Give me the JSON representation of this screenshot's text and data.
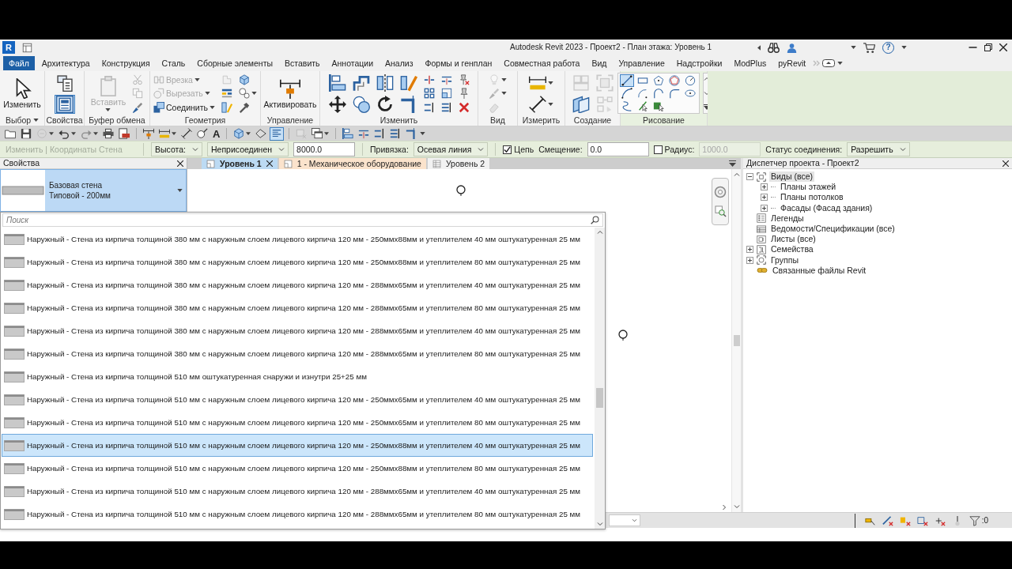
{
  "title_bar": {
    "logo": "R",
    "title": "Autodesk Revit 2023 - Проект2 - План этажа: Уровень 1",
    "help": "?"
  },
  "menu_tabs": [
    {
      "label": "Файл",
      "kind": "file",
      "selected": false
    },
    {
      "label": "Архитектура",
      "kind": "tab",
      "selected": false
    },
    {
      "label": "Конструкция",
      "kind": "tab",
      "selected": false
    },
    {
      "label": "Сталь",
      "kind": "tab",
      "selected": false
    },
    {
      "label": "Сборные элементы",
      "kind": "tab",
      "selected": false
    },
    {
      "label": "Вставить",
      "kind": "tab",
      "selected": false
    },
    {
      "label": "Аннотации",
      "kind": "tab",
      "selected": false
    },
    {
      "label": "Анализ",
      "kind": "tab",
      "selected": false
    },
    {
      "label": "Формы и генплан",
      "kind": "tab",
      "selected": false
    },
    {
      "label": "Совместная работа",
      "kind": "tab",
      "selected": false
    },
    {
      "label": "Вид",
      "kind": "tab",
      "selected": false
    },
    {
      "label": "Управление",
      "kind": "tab",
      "selected": false
    },
    {
      "label": "Надстройки",
      "kind": "tab",
      "selected": false
    },
    {
      "label": "ModPlus",
      "kind": "tab",
      "selected": false
    },
    {
      "label": "pyRevit",
      "kind": "tab",
      "selected": false
    }
  ],
  "ribbon": {
    "panels": [
      {
        "title": "Выбор",
        "kind": "tools",
        "menu": true,
        "columns": [
          [
            {
              "kind": "large",
              "label": "Изменить",
              "disabled": false,
              "menu": false,
              "on": false
            }
          ]
        ]
      },
      {
        "title": "Свойства",
        "kind": "tools",
        "menu": false,
        "columns": [
          [
            {
              "kind": "medium",
              "disabled": false,
              "menu": false,
              "on": false
            },
            {
              "kind": "medium",
              "disabled": false,
              "menu": false,
              "on": true
            }
          ]
        ]
      },
      {
        "title": "Буфер обмена",
        "kind": "tools",
        "menu": false,
        "columns": [
          [
            {
              "kind": "large",
              "label": "Вставить",
              "disabled": true,
              "menu": true,
              "on": false
            }
          ],
          [
            {
              "kind": "small",
              "disabled": true,
              "menu": false,
              "on": false
            },
            {
              "kind": "small",
              "disabled": true,
              "menu": false,
              "on": false
            },
            {
              "kind": "small",
              "disabled": false,
              "menu": false,
              "on": false
            }
          ]
        ]
      },
      {
        "title": "Геометрия",
        "kind": "tools",
        "menu": false,
        "columns": [
          [
            {
              "kind": "small",
              "label": "Врезка",
              "disabled": true,
              "menu": true,
              "on": false
            },
            {
              "kind": "small",
              "label": "Вырезать",
              "disabled": true,
              "menu": true,
              "on": false
            },
            {
              "kind": "small",
              "label": "Соединить",
              "disabled": false,
              "menu": true,
              "on": false
            }
          ],
          [
            {
              "kind": "small",
              "disabled": true,
              "menu": false,
              "on": false
            },
            {
              "kind": "small",
              "disabled": false,
              "menu": false,
              "on": false
            },
            {
              "kind": "small",
              "disabled": false,
              "menu": false,
              "on": false
            }
          ],
          [
            {
              "kind": "small",
              "disabled": false,
              "menu": false,
              "on": false
            },
            {
              "kind": "small",
              "disabled": false,
              "menu": true,
              "on": false
            },
            {
              "kind": "small",
              "disabled": false,
              "menu": false,
              "on": false
            }
          ]
        ]
      },
      {
        "title": "Управление",
        "kind": "tools",
        "menu": false,
        "columns": [
          [
            {
              "kind": "large",
              "label": "Активировать",
              "disabled": false,
              "menu": false,
              "on": false
            }
          ]
        ]
      },
      {
        "title": "Изменить",
        "kind": "tools",
        "menu": false,
        "columns": [
          [
            {
              "kind": "medium",
              "disabled": false,
              "menu": false,
              "on": false
            },
            {
              "kind": "medium",
              "disabled": false,
              "menu": false,
              "on": false
            }
          ],
          [
            {
              "kind": "medium",
              "disabled": false,
              "menu": false,
              "on": false
            },
            {
              "kind": "medium",
              "disabled": false,
              "menu": false,
              "on": false
            }
          ],
          [
            {
              "kind": "medium",
              "disabled": false,
              "menu": false,
              "on": false
            },
            {
              "kind": "medium",
              "disabled": false,
              "menu": false,
              "on": false
            }
          ],
          [
            {
              "kind": "medium",
              "disabled": false,
              "menu": false,
              "on": false
            },
            {
              "kind": "medium",
              "disabled": false,
              "menu": false,
              "on": false
            }
          ],
          [
            {
              "kind": "small",
              "disabled": false,
              "menu": false,
              "on": false
            },
            {
              "kind": "small",
              "disabled": false,
              "menu": false,
              "on": false
            },
            {
              "kind": "small",
              "disabled": false,
              "menu": false,
              "on": false
            }
          ],
          [
            {
              "kind": "small",
              "disabled": false,
              "menu": false,
              "on": false
            },
            {
              "kind": "small",
              "disabled": false,
              "menu": false,
              "on": false
            },
            {
              "kind": "small",
              "disabled": false,
              "menu": false,
              "on": false
            }
          ],
          [
            {
              "kind": "small",
              "disabled": false,
              "menu": false,
              "on": false
            },
            {
              "kind": "small",
              "disabled": false,
              "menu": false,
              "on": false
            },
            {
              "kind": "small",
              "disabled": false,
              "menu": false,
              "on": false
            }
          ]
        ]
      },
      {
        "title": "Вид",
        "kind": "tools",
        "menu": false,
        "columns": [
          [
            {
              "kind": "small",
              "disabled": true,
              "menu": true,
              "on": false
            },
            {
              "kind": "small",
              "disabled": true,
              "menu": true,
              "on": false
            },
            {
              "kind": "small",
              "disabled": true,
              "menu": false,
              "on": false
            }
          ]
        ]
      },
      {
        "title": "Измерить",
        "kind": "tools",
        "menu": false,
        "columns": [
          [
            {
              "kind": "medium",
              "disabled": false,
              "menu": true,
              "on": false
            },
            {
              "kind": "medium",
              "disabled": false,
              "menu": true,
              "on": false
            }
          ]
        ]
      },
      {
        "title": "Создание",
        "kind": "tools",
        "menu": false,
        "columns": [
          [
            {
              "kind": "medium",
              "disabled": true,
              "menu": false,
              "on": false
            },
            {
              "kind": "medium",
              "disabled": false,
              "menu": false,
              "on": false
            }
          ],
          [
            {
              "kind": "medium",
              "disabled": true,
              "menu": false,
              "on": false
            },
            {
              "kind": "medium",
              "disabled": true,
              "menu": false,
              "on": false
            }
          ]
        ]
      },
      {
        "title": "Рисование",
        "kind": "palette",
        "menu": false,
        "items": [
          {
            "selected": true
          },
          {
            "selected": false
          },
          {
            "selected": false
          },
          {
            "selected": false
          },
          {
            "selected": false
          },
          {
            "selected": false
          },
          {
            "selected": false
          },
          {
            "selected": false
          },
          {
            "selected": false
          },
          {
            "selected": false
          },
          {
            "selected": false
          },
          {
            "selected": false
          },
          {
            "selected": false
          }
        ]
      }
    ]
  },
  "quick_access": [
    {
      "kind": "icon",
      "menu": false,
      "disabled": false,
      "on": false
    },
    {
      "kind": "icon",
      "menu": false,
      "disabled": false,
      "on": false
    },
    {
      "kind": "icon",
      "menu": true,
      "disabled": true,
      "on": false
    },
    {
      "kind": "icon",
      "menu": true,
      "disabled": false,
      "on": false
    },
    {
      "kind": "icon",
      "menu": true,
      "disabled": true,
      "on": false
    },
    {
      "kind": "icon",
      "menu": false,
      "disabled": false,
      "on": false
    },
    {
      "kind": "icon",
      "menu": false,
      "disabled": false,
      "on": false
    },
    {
      "kind": "separator"
    },
    {
      "kind": "icon",
      "menu": false,
      "disabled": false,
      "on": false
    },
    {
      "kind": "icon",
      "menu": true,
      "disabled": false,
      "on": false
    },
    {
      "kind": "icon",
      "menu": false,
      "disabled": false,
      "on": false
    },
    {
      "kind": "icon",
      "menu": false,
      "disabled": false,
      "on": false
    },
    {
      "kind": "glyph",
      "text": "A",
      "menu": false,
      "disabled": false,
      "on": false
    },
    {
      "kind": "separator"
    },
    {
      "kind": "icon",
      "menu": true,
      "disabled": false,
      "on": false
    },
    {
      "kind": "icon",
      "menu": false,
      "disabled": false,
      "on": false
    },
    {
      "kind": "icon",
      "menu": false,
      "disabled": false,
      "on": true
    },
    {
      "kind": "separator"
    },
    {
      "kind": "icon",
      "menu": false,
      "disabled": true,
      "on": false
    },
    {
      "kind": "icon",
      "menu": true,
      "disabled": false,
      "on": false
    },
    {
      "kind": "separator"
    },
    {
      "kind": "icon",
      "menu": false,
      "disabled": false,
      "on": false
    },
    {
      "kind": "icon",
      "menu": false,
      "disabled": false,
      "on": false
    },
    {
      "kind": "icon",
      "menu": false,
      "disabled": false,
      "on": false
    },
    {
      "kind": "icon",
      "menu": false,
      "disabled": false,
      "on": false
    },
    {
      "kind": "icon",
      "menu": false,
      "disabled": false,
      "on": false
    },
    {
      "kind": "menu"
    }
  ],
  "options_bar": {
    "context": "Изменить | Координаты Стена",
    "fields": [
      {
        "kind": "select",
        "value": "Высота:"
      },
      {
        "kind": "select",
        "value": "Неприсоединен"
      },
      {
        "kind": "input",
        "value": "8000.0",
        "disabled": false
      },
      {
        "kind": "separator"
      },
      {
        "kind": "label",
        "text": "Привязка:"
      },
      {
        "kind": "select",
        "value": "Осевая линия"
      },
      {
        "kind": "separator"
      },
      {
        "kind": "check",
        "label": "Цепь",
        "checked": true
      },
      {
        "kind": "label",
        "text": "Смещение:"
      },
      {
        "kind": "input",
        "value": "0.0",
        "disabled": false
      },
      {
        "kind": "check",
        "label": "Радиус:",
        "checked": false
      },
      {
        "kind": "input",
        "value": "1000.0",
        "disabled": true
      },
      {
        "kind": "label",
        "text": "Статус соединения:"
      },
      {
        "kind": "select",
        "value": "Разрешить"
      }
    ]
  },
  "properties": {
    "title": "Свойства",
    "type_family": "Базовая стена",
    "type_name": "Типовой - 200мм"
  },
  "view_tabs": [
    {
      "label": "Уровень 1",
      "selected": true,
      "color": "#bcdaf3"
    },
    {
      "label": "1 - Механическое оборудование",
      "selected": false,
      "color": "#fbe3cc"
    },
    {
      "label": "Уровень 2",
      "selected": false,
      "color": "#f2f2f2"
    }
  ],
  "type_list": {
    "placeholder": "Поиск",
    "items": [
      {
        "label": "Наружный - Стена из кирпича толщиной 380 мм с наружным слоем лицевого кирпича 120 мм - 250ммх88мм и утеплителем 40 мм оштукатуренная 25 мм",
        "selected": false
      },
      {
        "label": "Наружный - Стена из кирпича толщиной 380 мм с наружным слоем лицевого кирпича 120 мм - 250ммх88мм и утеплителем 80 мм оштукатуренная 25 мм",
        "selected": false
      },
      {
        "label": "Наружный - Стена из кирпича толщиной 380 мм с наружным слоем лицевого кирпича 120 мм - 288ммх65мм и утеплителем 40 мм оштукатуренная 25 мм",
        "selected": false
      },
      {
        "label": "Наружный - Стена из кирпича толщиной 380 мм с наружным слоем лицевого кирпича 120 мм - 288ммх65мм и утеплителем 80 мм оштукатуренная 25 мм",
        "selected": false
      },
      {
        "label": "Наружный - Стена из кирпича толщиной 380 мм с наружным слоем лицевого кирпича 120 мм - 288ммх65мм и утеплителем 40 мм оштукатуренная 25 мм",
        "selected": false
      },
      {
        "label": "Наружный - Стена из кирпича толщиной 380 мм с наружным слоем лицевого кирпича 120 мм - 288ммх65мм и утеплителем 80 мм оштукатуренная 25 мм",
        "selected": false
      },
      {
        "label": "Наружный - Стена из кирпича толщиной 510 мм оштукатуренная снаружи и изнутри 25+25 мм",
        "selected": false
      },
      {
        "label": "Наружный - Стена из кирпича толщиной 510 мм с наружным слоем лицевого кирпича 120 мм - 250ммх65мм и утеплителем 40 мм оштукатуренная 25 мм",
        "selected": false
      },
      {
        "label": "Наружный - Стена из кирпича толщиной 510 мм с наружным слоем лицевого кирпича 120 мм - 250ммх65мм и утеплителем 80 мм оштукатуренная 25 мм",
        "selected": false
      },
      {
        "label": "Наружный - Стена из кирпича толщиной 510 мм с наружным слоем лицевого кирпича 120 мм - 250ммх88мм и утеплителем 40 мм оштукатуренная 25 мм",
        "selected": true
      },
      {
        "label": "Наружный - Стена из кирпича толщиной 510 мм с наружным слоем лицевого кирпича 120 мм - 250ммх88мм и утеплителем 80 мм оштукатуренная 25 мм",
        "selected": false
      },
      {
        "label": "Наружный - Стена из кирпича толщиной 510 мм с наружным слоем лицевого кирпича 120 мм - 288ммх65мм и утеплителем 40 мм оштукатуренная 25 мм",
        "selected": false
      },
      {
        "label": "Наружный - Стена из кирпича толщиной 510 мм с наружным слоем лицевого кирпича 120 мм - 288ммх65мм и утеплителем 80 мм оштукатуренная 25 мм",
        "selected": false
      }
    ]
  },
  "project_browser": {
    "title": "Диспетчер проекта - Проект2",
    "tree": [
      {
        "label": "Виды (все)",
        "kind": "group",
        "expanded": true,
        "selected": true,
        "children": [
          {
            "label": "Планы этажей",
            "kind": "group",
            "expanded": false,
            "selected": false
          },
          {
            "label": "Планы потолков",
            "kind": "group",
            "expanded": false,
            "selected": false
          },
          {
            "label": "Фасады (Фасад здания)",
            "kind": "group",
            "expanded": false,
            "selected": false
          }
        ]
      },
      {
        "label": "Легенды",
        "kind": "leaf",
        "selected": false
      },
      {
        "label": "Ведомости/Спецификации (все)",
        "kind": "leaf",
        "selected": false
      },
      {
        "label": "Листы (все)",
        "kind": "leaf",
        "selected": false
      },
      {
        "label": "Семейства",
        "kind": "group",
        "expanded": false,
        "selected": false
      },
      {
        "label": "Группы",
        "kind": "group",
        "expanded": false,
        "selected": false
      },
      {
        "label": "Связанные файлы Revit",
        "kind": "leaf",
        "selected": false
      }
    ]
  },
  "status_bar": {
    "filter_count": ":0"
  }
}
